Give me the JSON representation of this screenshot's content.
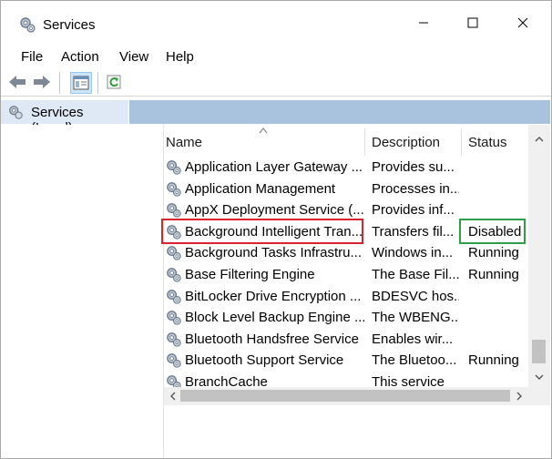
{
  "window": {
    "title": "Services",
    "icon": "services-gear-icon",
    "controls": [
      "minimize-icon",
      "maximize-icon",
      "close-icon"
    ]
  },
  "menu": {
    "items": [
      "File",
      "Action",
      "View",
      "Help"
    ]
  },
  "toolbar": {
    "buttons": [
      "back-arrow-icon",
      "forward-arrow-icon",
      "show-hide-console-tree-icon",
      "refresh-icon"
    ]
  },
  "tree": {
    "selected": "Services (Local)",
    "icon": "services-gear-icon"
  },
  "table": {
    "columns": {
      "name": "Name",
      "description": "Description",
      "status": "Status"
    },
    "sorted_column": "Name",
    "rows": [
      {
        "name": "Application Layer Gateway ...",
        "description": "Provides su...",
        "status": ""
      },
      {
        "name": "Application Management",
        "description": "Processes in...",
        "status": ""
      },
      {
        "name": "AppX Deployment Service (...",
        "description": "Provides inf...",
        "status": ""
      },
      {
        "name": "Background Intelligent Tran...",
        "description": "Transfers fil...",
        "status": "Disabled"
      },
      {
        "name": "Background Tasks Infrastru...",
        "description": "Windows in...",
        "status": "Running"
      },
      {
        "name": "Base Filtering Engine",
        "description": "The Base Fil...",
        "status": "Running"
      },
      {
        "name": "BitLocker Drive Encryption ...",
        "description": "BDESVC hos...",
        "status": ""
      },
      {
        "name": "Block Level Backup Engine ...",
        "description": "The WBENG...",
        "status": ""
      },
      {
        "name": "Bluetooth Handsfree Service",
        "description": "Enables wir...",
        "status": ""
      },
      {
        "name": "Bluetooth Support Service",
        "description": "The Bluetoo...",
        "status": "Running"
      },
      {
        "name": "BranchCache",
        "description": "This service",
        "status": ""
      }
    ],
    "highlight": {
      "row_name_color": "#d9232d",
      "status_color": "#2e9e4a"
    }
  },
  "colors": {
    "tree_header_bg": "#dfe9f5",
    "header_bar_bg": "#a9c3df",
    "scrollbar_bg": "#f0f0f0"
  }
}
